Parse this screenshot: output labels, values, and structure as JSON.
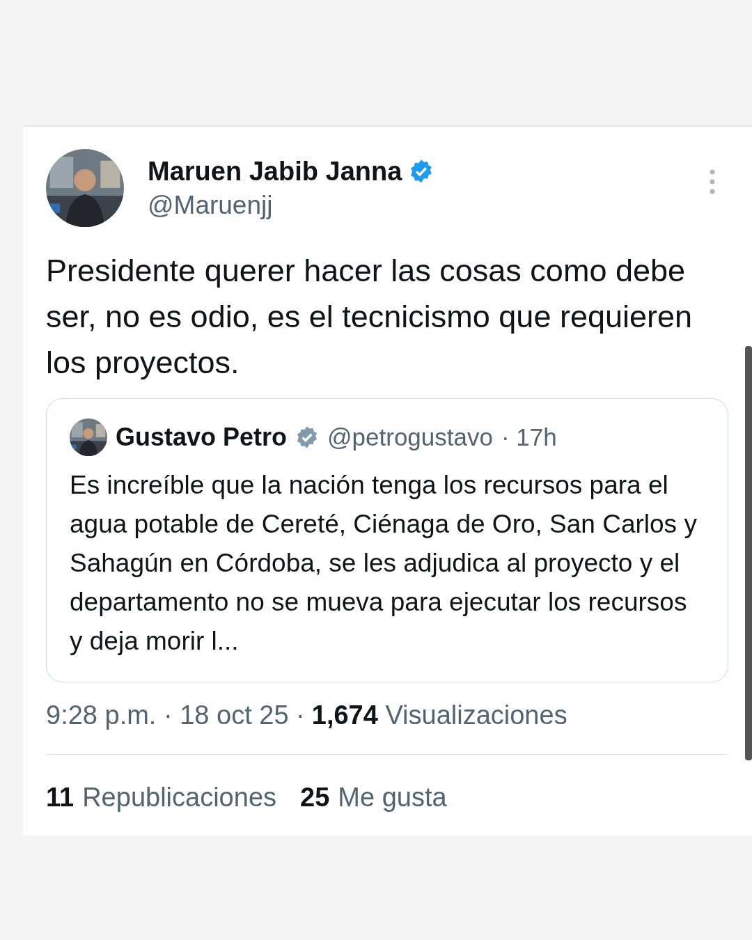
{
  "author": {
    "name": "Maruen Jabib Janna",
    "verified": true,
    "handle": "@Maruenjj"
  },
  "text": "Presidente querer hacer las cosas como debe ser, no es odio, es el tecnicismo que requieren los proyectos.",
  "quote": {
    "name": "Gustavo Petro",
    "verified": true,
    "handle": "@petrogustavo",
    "time": "· 17h",
    "text": "Es increíble que la nación tenga los recursos para el agua potable de Cereté, Ciénaga de Oro, San Carlos y Sahagún en Córdoba, se les adjudica al proyecto y el departamento no se mueva para ejecutar los recursos y deja morir l..."
  },
  "meta": {
    "time": "9:28 p.m. · 18 oct 25 ·",
    "views_count": "1,674",
    "views_label": "Visualizaciones"
  },
  "stats": [
    {
      "count": "11",
      "label": "Republicaciones"
    },
    {
      "count": "25",
      "label": "Me gusta"
    }
  ]
}
